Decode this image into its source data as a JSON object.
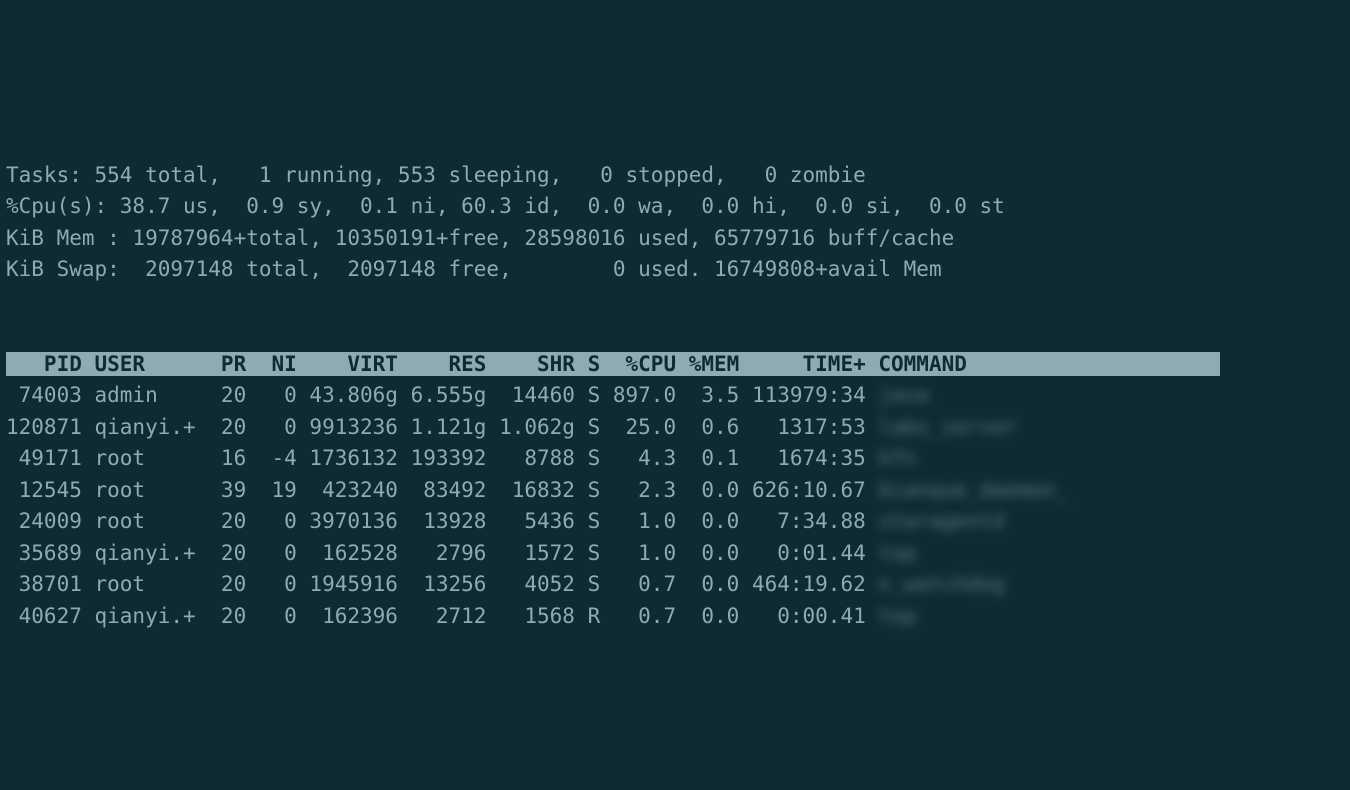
{
  "summary": {
    "tasks_line": "Tasks: 554 total,   1 running, 553 sleeping,   0 stopped,   0 zombie",
    "cpu_line": "%Cpu(s): 38.7 us,  0.9 sy,  0.1 ni, 60.3 id,  0.0 wa,  0.0 hi,  0.0 si,  0.0 st",
    "mem_line": "KiB Mem : 19787964+total, 10350191+free, 28598016 used, 65779716 buff/cache",
    "swap_line": "KiB Swap:  2097148 total,  2097148 free,        0 used. 16749808+avail Mem"
  },
  "header": "   PID USER      PR  NI    VIRT    RES    SHR S  %CPU %MEM     TIME+ COMMAND                    ",
  "rows": [
    {
      "pid": " 74003",
      "user": "admin   ",
      "pr": "20",
      "ni": "  0",
      "virt": "43.806g",
      "res": "6.555g",
      "shr": " 14460",
      "s": "S",
      "cpu": "897.0",
      "mem": " 3.5",
      "time": "113979:34",
      "cmd": "java"
    },
    {
      "pid": "120871",
      "user": "qianyi.+",
      "pr": "20",
      "ni": "  0",
      "virt": "9913236",
      "res": "1.121g",
      "shr": "1.062g",
      "s": "S",
      "cpu": " 25.0",
      "mem": " 0.6",
      "time": "  1317:53",
      "cmd": "labs_server"
    },
    {
      "pid": " 49171",
      "user": "root    ",
      "pr": "16",
      "ni": " -4",
      "virt": "1736132",
      "res": "193392",
      "shr": "  8788",
      "s": "S",
      "cpu": "  4.3",
      "mem": " 0.1",
      "time": "  1674:35",
      "cmd": "kfn"
    },
    {
      "pid": " 12545",
      "user": "root    ",
      "pr": "39",
      "ni": " 19",
      "virt": " 423240",
      "res": " 83492",
      "shr": " 16832",
      "s": "S",
      "cpu": "  2.3",
      "mem": " 0.0",
      "time": "626:10.67",
      "cmd": "bianque_daemon_"
    },
    {
      "pid": " 24009",
      "user": "root    ",
      "pr": "20",
      "ni": "  0",
      "virt": "3970136",
      "res": " 13928",
      "shr": "  5436",
      "s": "S",
      "cpu": "  1.0",
      "mem": " 0.0",
      "time": "  7:34.88",
      "cmd": "staragentd"
    },
    {
      "pid": " 35689",
      "user": "qianyi.+",
      "pr": "20",
      "ni": "  0",
      "virt": " 162528",
      "res": "  2796",
      "shr": "  1572",
      "s": "S",
      "cpu": "  1.0",
      "mem": " 0.0",
      "time": "  0:01.44",
      "cmd": "top"
    },
    {
      "pid": " 38701",
      "user": "root    ",
      "pr": "20",
      "ni": "  0",
      "virt": "1945916",
      "res": " 13256",
      "shr": "  4052",
      "s": "S",
      "cpu": "  0.7",
      "mem": " 0.0",
      "time": "464:19.62",
      "cmd": "n_watchdog"
    },
    {
      "pid": " 40627",
      "user": "qianyi.+",
      "pr": "20",
      "ni": "  0",
      "virt": " 162396",
      "res": "  2712",
      "shr": "  1568",
      "s": "R",
      "cpu": "  0.7",
      "mem": " 0.0",
      "time": "  0:00.41",
      "cmd": "top"
    }
  ]
}
